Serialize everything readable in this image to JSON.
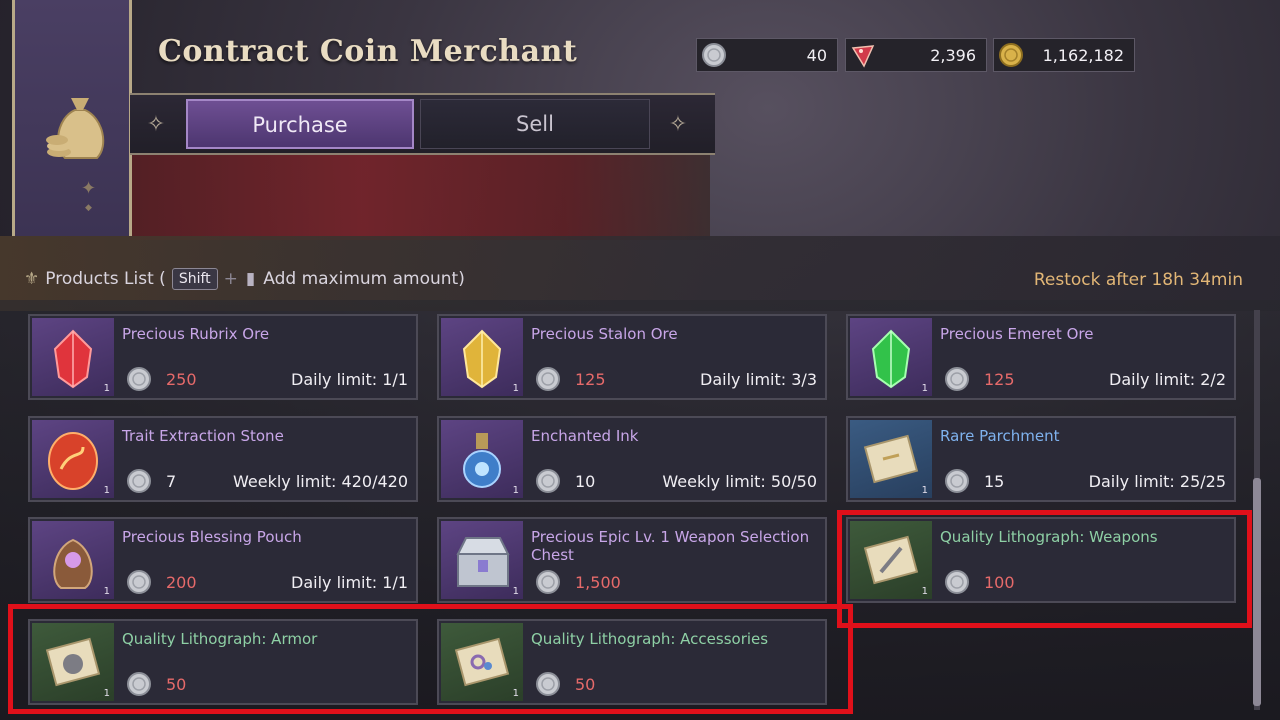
{
  "header": {
    "title": "Contract Coin Merchant"
  },
  "currencies": [
    {
      "icon": "silver-coin-icon",
      "value": "40"
    },
    {
      "icon": "red-gem-icon",
      "value": "2,396"
    },
    {
      "icon": "gold-coin-icon",
      "value": "1,162,182"
    }
  ],
  "tabs": {
    "purchase": "Purchase",
    "sell": "Sell",
    "active": "Purchase"
  },
  "products_header": {
    "label": "Products List (",
    "shift_key": "Shift",
    "plus": "+",
    "hint": "Add maximum amount)",
    "restock": "Restock after  18h 34min"
  },
  "products": [
    {
      "name": "Precious Rubrix Ore",
      "price": "250",
      "limit": "Daily limit: 1/1",
      "qty": "1",
      "rarity": "purple",
      "price_color": "red",
      "icon": "red-ore-icon"
    },
    {
      "name": "Precious Stalon Ore",
      "price": "125",
      "limit": "Daily limit: 3/3",
      "qty": "1",
      "rarity": "purple",
      "price_color": "red",
      "icon": "yellow-ore-icon"
    },
    {
      "name": "Precious Emeret Ore",
      "price": "125",
      "limit": "Daily limit: 2/2",
      "qty": "1",
      "rarity": "purple",
      "price_color": "red",
      "icon": "green-ore-icon"
    },
    {
      "name": "Trait Extraction Stone",
      "price": "7",
      "limit": "Weekly limit: 420/420",
      "qty": "1",
      "rarity": "purple",
      "price_color": "white",
      "icon": "extraction-stone-icon"
    },
    {
      "name": "Enchanted Ink",
      "price": "10",
      "limit": "Weekly limit: 50/50",
      "qty": "1",
      "rarity": "purple",
      "price_color": "white",
      "icon": "ink-bottle-icon"
    },
    {
      "name": "Rare Parchment",
      "price": "15",
      "limit": "Daily limit: 25/25",
      "qty": "1",
      "rarity": "blue",
      "price_color": "white",
      "icon": "parchment-scroll-icon"
    },
    {
      "name": "Precious Blessing Pouch",
      "price": "200",
      "limit": "Daily limit: 1/1",
      "qty": "1",
      "rarity": "purple",
      "price_color": "red",
      "icon": "blessing-pouch-icon"
    },
    {
      "name": "Precious Epic Lv. 1 Weapon Selection Chest",
      "price": "1,500",
      "limit": "",
      "qty": "1",
      "rarity": "purple",
      "price_color": "red",
      "icon": "treasure-chest-icon"
    },
    {
      "name": "Quality Lithograph: Weapons",
      "price": "100",
      "limit": "",
      "qty": "1",
      "rarity": "green",
      "price_color": "red",
      "icon": "lithograph-weapons-icon"
    },
    {
      "name": "Quality Lithograph: Armor",
      "price": "50",
      "limit": "",
      "qty": "1",
      "rarity": "green",
      "price_color": "red",
      "icon": "lithograph-armor-icon"
    },
    {
      "name": "Quality Lithograph: Accessories",
      "price": "50",
      "limit": "",
      "qty": "1",
      "rarity": "green",
      "price_color": "red",
      "icon": "lithograph-accessories-icon"
    }
  ],
  "colors": {
    "highlight": "#e0101a",
    "tab_active": "#5b3f80",
    "restock": "#e2b676",
    "price_red": "#e66a6a"
  }
}
